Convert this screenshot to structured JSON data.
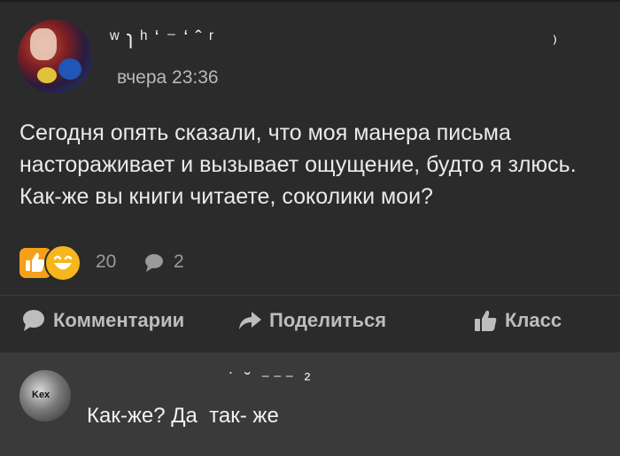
{
  "post": {
    "author_name_visible": "ʷ  ɿ  ʰ   ʻ  ⁻        ʻ  ˆ   ʳ",
    "author_name_tail": "⁾",
    "time": "вчера 23:36",
    "text": "Сегодня опять сказали, что моя манера письма настораживает и вызывает ощущение, будто я злюсь. Как-же вы книги читаете, соколики мои?",
    "reaction_count": "20",
    "comment_count": "2"
  },
  "actions": {
    "comments_label": "Комментарии",
    "share_label": "Поделиться",
    "class_label": "Класс"
  },
  "comment": {
    "author_fragment": "˙        ˘      ⁻⁻⁻ ²",
    "text": "Как-же? Да  так- же",
    "avatar_text": "Kex"
  },
  "colors": {
    "background": "#2b2b2b",
    "comment_background": "#3a3a3a",
    "reaction_orange": "#f4a019",
    "text": "#eaeaea",
    "muted": "#9a9a9a"
  },
  "icons": {
    "like_reaction": "thumbs-up-icon",
    "smile_reaction": "laughing-face-icon",
    "comment": "speech-bubble-icon",
    "share": "share-arrow-icon",
    "class": "thumbs-up-icon"
  }
}
